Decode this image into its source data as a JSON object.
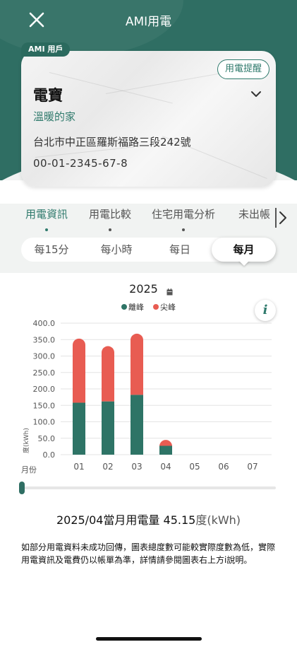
{
  "header": {
    "title": "AMI用電",
    "close_icon": "close-icon"
  },
  "account": {
    "badge": "AMI 用戶",
    "name": "電寶",
    "subtitle": "溫暖的家",
    "address": "台北市中正區羅斯福路三段242號",
    "number": "00-01-2345-67-8",
    "reminder_label": "用電提醒"
  },
  "tabs": [
    {
      "label": "用電資訊",
      "active": true
    },
    {
      "label": "用電比較",
      "active": false
    },
    {
      "label": "住宅用電分析",
      "active": false
    },
    {
      "label": "未出帳",
      "active": false
    }
  ],
  "periods": [
    {
      "label": "每15分",
      "active": false
    },
    {
      "label": "每小時",
      "active": false
    },
    {
      "label": "每日",
      "active": false
    },
    {
      "label": "每月",
      "active": true
    }
  ],
  "colors": {
    "primary": "#2f6e63",
    "offpeak": "#2e7466",
    "peak": "#e85c52"
  },
  "chart_data": {
    "type": "bar",
    "stacked": true,
    "title": "2025",
    "categories": [
      "01",
      "02",
      "03",
      "04",
      "05",
      "06",
      "07"
    ],
    "series": [
      {
        "name": "離峰",
        "color": "#2e7466",
        "values": [
          158,
          162,
          182,
          27,
          0,
          0,
          0
        ]
      },
      {
        "name": "尖峰",
        "color": "#e85c52",
        "values": [
          195,
          168,
          186,
          18,
          0,
          0,
          0
        ]
      }
    ],
    "yticks": [
      "400.0",
      "350.0",
      "300.0",
      "250.0",
      "200.0",
      "150.0",
      "100.0",
      "50.0",
      "0.0"
    ],
    "ylim": [
      0,
      400
    ],
    "ylabel": "度(kWh)",
    "xlabel": "月份",
    "grid": true,
    "legend_position": "top"
  },
  "summary": {
    "prefix": "2025/04當月用電量 45.15",
    "unit": "度(kWh)"
  },
  "note": "如部分用電資料未成功回傳，圖表總度數可能較實際度數為低，實際用電資訊及電費仍以帳單為準，詳情請參閱圖表右上方i說明。"
}
